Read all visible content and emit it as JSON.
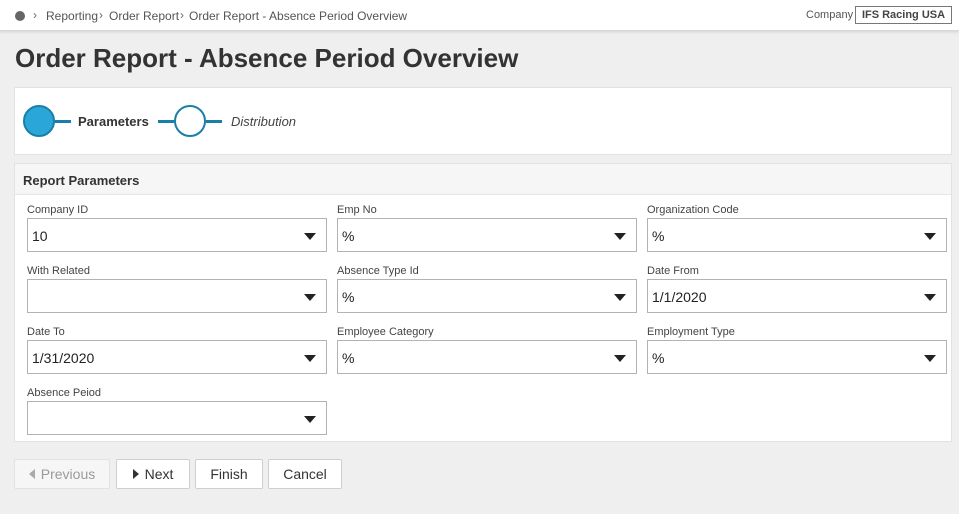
{
  "breadcrumb": {
    "items": [
      "Reporting",
      "Order Report",
      "Order Report - Absence Period Overview"
    ],
    "separator": ">"
  },
  "company": {
    "label": "Company",
    "value": "IFS Racing USA"
  },
  "page_title": "Order Report - Absence Period Overview",
  "stepper": {
    "steps": [
      {
        "label": "Parameters",
        "state": "active"
      },
      {
        "label": "Distribution",
        "state": "pending"
      }
    ],
    "accent_color": "#1a7fa8",
    "active_fill": "#2aa7d8"
  },
  "params": {
    "title": "Report Parameters",
    "fields": [
      {
        "label": "Company ID",
        "value": "10"
      },
      {
        "label": "Emp No",
        "value": "%"
      },
      {
        "label": "Organization Code",
        "value": "%"
      },
      {
        "label": "With Related",
        "value": ""
      },
      {
        "label": "Absence Type Id",
        "value": "%"
      },
      {
        "label": "Date From",
        "value": "1/1/2020"
      },
      {
        "label": "Date To",
        "value": "1/31/2020"
      },
      {
        "label": "Employee Category",
        "value": "%"
      },
      {
        "label": "Employment Type",
        "value": "%"
      },
      {
        "label": "Absence Peiod",
        "value": ""
      }
    ]
  },
  "buttons": {
    "previous": "Previous",
    "next": "Next",
    "finish": "Finish",
    "cancel": "Cancel"
  }
}
